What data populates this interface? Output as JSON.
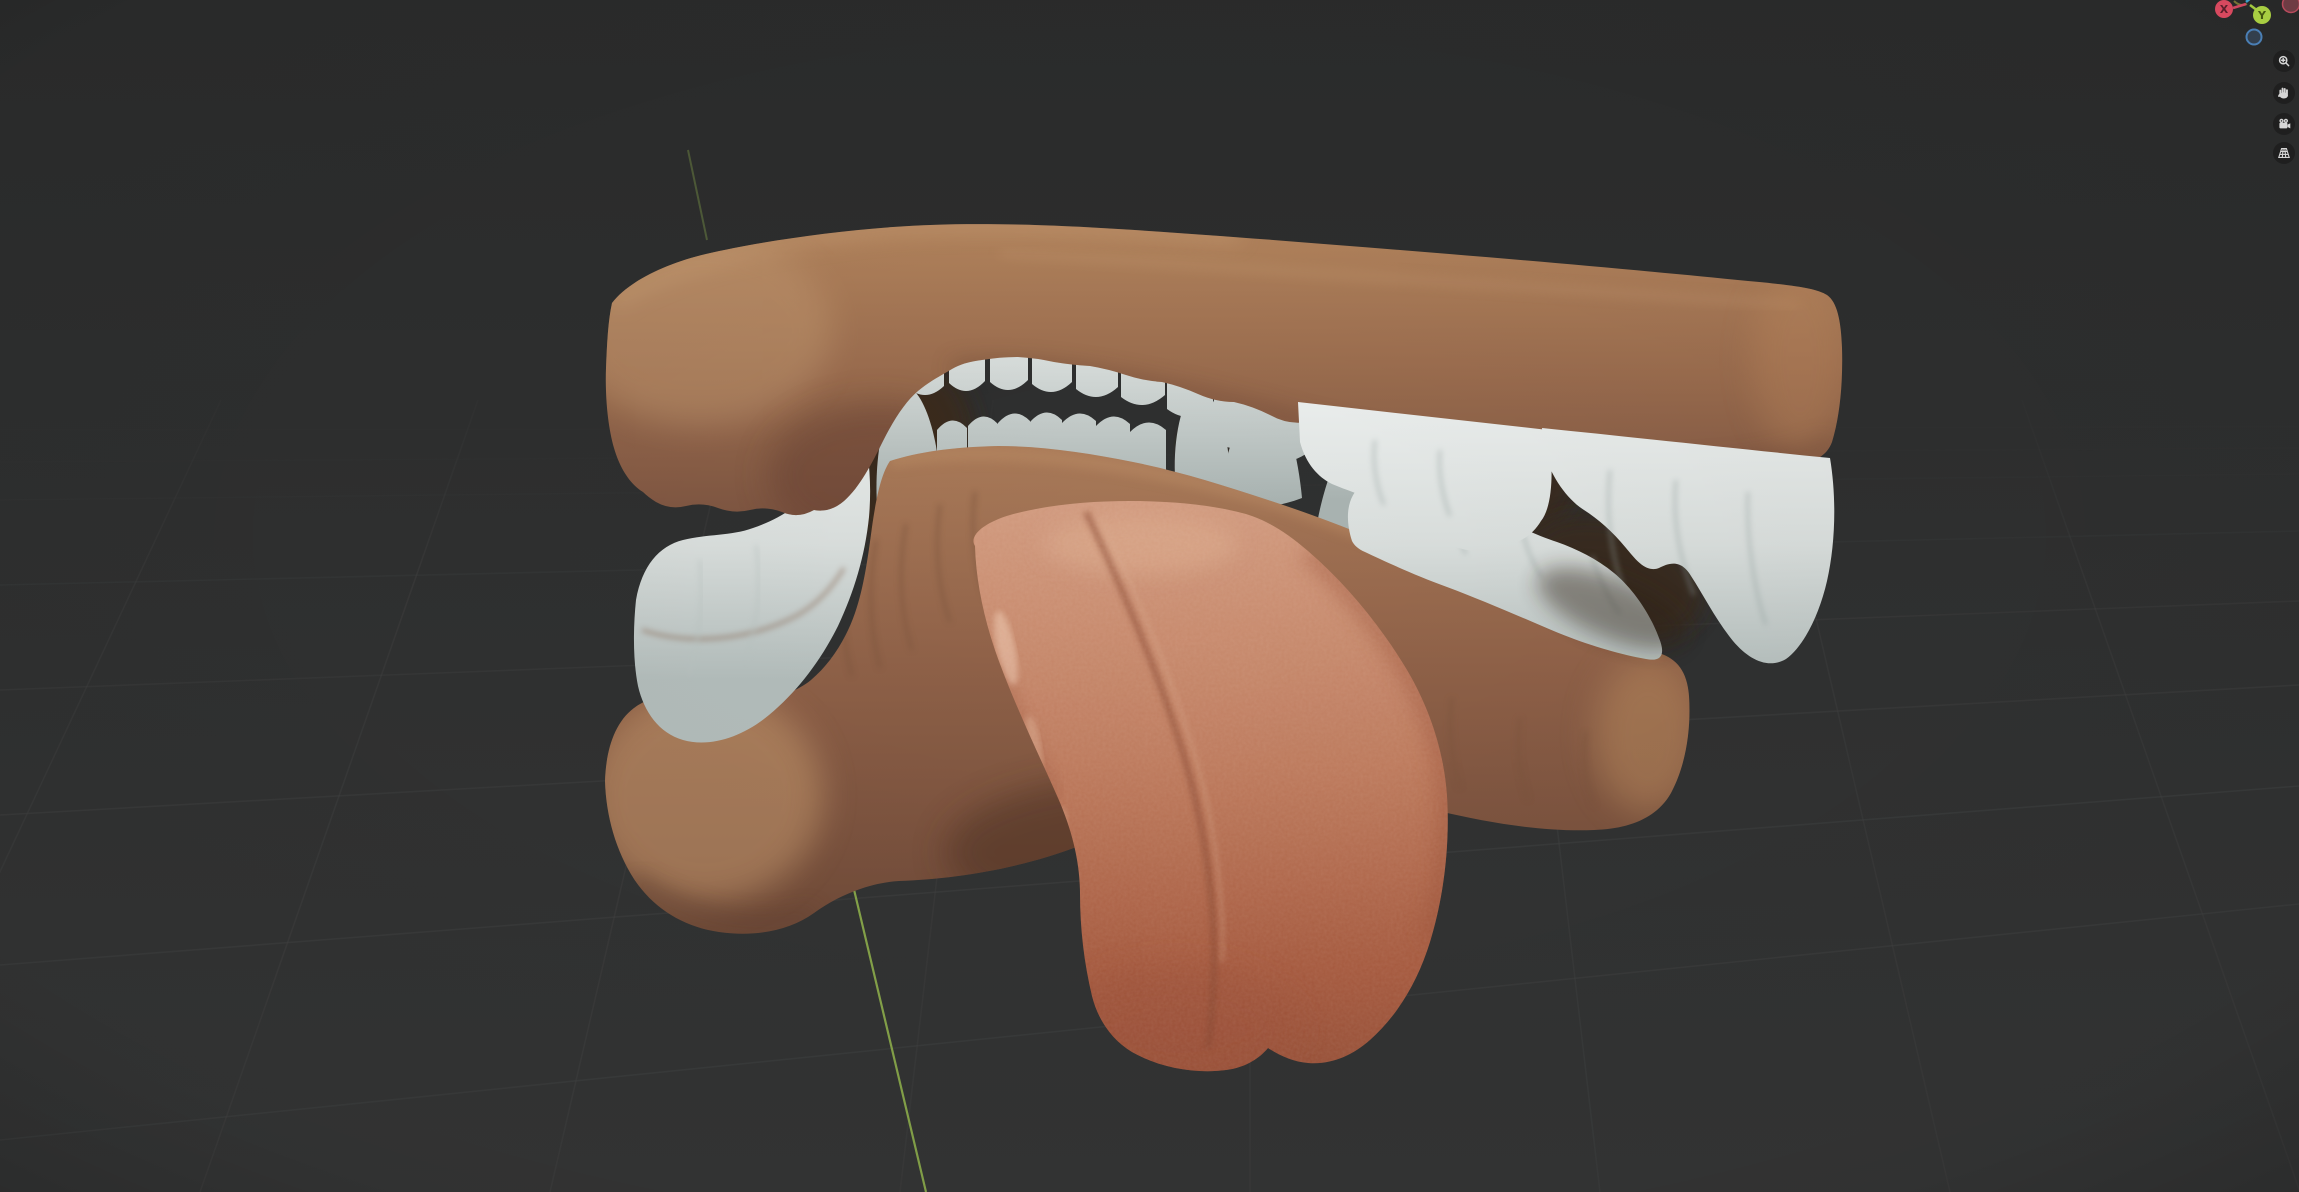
{
  "viewport": {
    "background_top": "#2b2c2c",
    "background_bottom": "#343535",
    "grid_color": "#424343",
    "axis_line": {
      "axis": "Y",
      "color": "#8fb04c"
    },
    "gizmo": {
      "x_label": "X",
      "y_label": "Y",
      "x_color": "#d8495f",
      "y_color": "#a8ce42",
      "x_letter_color": "#5c1f2b",
      "y_letter_color": "#445712",
      "neg_x_fill": "#6e3c44",
      "neg_x_ring": "#b84a5c",
      "neg_z_fill": "#333f4d",
      "neg_z_ring": "#4a7fb5",
      "line_x_color": "#cf4860",
      "line_y_color": "#a2c83e",
      "line_z_color": "#3d9dc9"
    },
    "nav_buttons": [
      {
        "name": "zoom-button",
        "icon": "magnifier-plus-icon"
      },
      {
        "name": "pan-button",
        "icon": "hand-icon"
      },
      {
        "name": "camera-view-button",
        "icon": "camera-icon"
      },
      {
        "name": "toggle-projection-button",
        "icon": "perspective-grid-icon"
      }
    ],
    "button_bg": "#1c1c1c",
    "icon_color": "#d6d6d6"
  },
  "scene": {
    "model": "Open mouth sculpt: upper jaw, lower jaw, teeth and extended tongue",
    "parts": [
      {
        "name": "upper-jaw-gum",
        "color": "#9a6c4e"
      },
      {
        "name": "upper-teeth",
        "color": "#d9dedc"
      },
      {
        "name": "lower-jaw-gum",
        "color": "#8f6148"
      },
      {
        "name": "lower-teeth",
        "color": "#d3d9d7"
      },
      {
        "name": "tongue",
        "color": "#c07c5e"
      },
      {
        "name": "mouth-interior-shadow",
        "color": "#3a2a1f"
      }
    ]
  }
}
